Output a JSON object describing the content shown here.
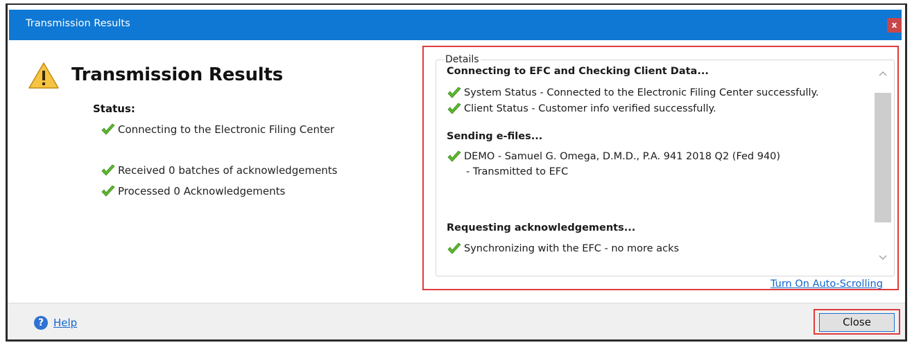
{
  "window": {
    "title": "Transmission Results",
    "close_glyph": "x"
  },
  "main": {
    "heading": "Transmission Results",
    "status_label": "Status:",
    "status_items": [
      "Connecting to the Electronic Filing Center",
      "Received 0 batches of acknowledgements",
      "Processed 0 Acknowledgements"
    ]
  },
  "details": {
    "legend": "Details",
    "section1_title": "Connecting to EFC and Checking Client Data...",
    "section1_lines": [
      "System Status - Connected to the Electronic Filing Center successfully.",
      "Client Status - Customer info verified successfully."
    ],
    "section2_title": "Sending e-files...",
    "section2_line": "DEMO - Samuel G. Omega, D.M.D., P.A. 941 2018 Q2 (Fed 940)",
    "section2_sub": "- Transmitted to EFC",
    "section3_title": "Requesting acknowledgements...",
    "section3_line": "Synchronizing with the EFC - no more acks",
    "autoscroll_link": "Turn On Auto-Scrolling"
  },
  "footer": {
    "help_label": "Help",
    "help_glyph": "?",
    "close_label": "Close"
  },
  "colors": {
    "titlebar": "#0f78d4",
    "close_x_bg": "#c8474a",
    "highlight_red": "#e0393b",
    "check_green": "#5bb82e",
    "link_blue": "#1166cc"
  },
  "icons": [
    "warning-icon",
    "check-icon",
    "help-icon",
    "chevron-up-icon",
    "chevron-down-icon"
  ]
}
